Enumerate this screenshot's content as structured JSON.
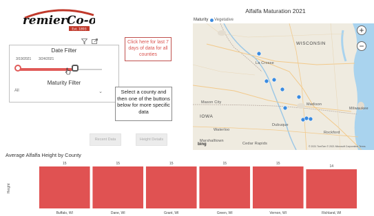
{
  "logo": {
    "text": "PremierCo-op",
    "subtext": "Est. 1893"
  },
  "date_filter": {
    "title": "Date Filter",
    "start_date": "3/19/2021",
    "end_date": "3/24/2021",
    "range_start_fraction": 0.0,
    "range_end_fraction": 0.68
  },
  "maturity_filter": {
    "title": "Maturity Filter",
    "selected": "All"
  },
  "last7_link": {
    "label": "Click here for last 7 days of data for all counties"
  },
  "instruction": {
    "text": "Select a county and then one of the buttons below for more specific data"
  },
  "buttons": {
    "recent": "Recent Data",
    "height": "Height Details"
  },
  "map": {
    "title": "Alfalfa Maturation 2021",
    "legend_label": "Maturity",
    "legend_item": "Vegetative",
    "legend_color": "#3b8be0",
    "labels": {
      "wisconsin": "WISCONSIN",
      "lacrosse": "La Crosse",
      "madison": "Madison",
      "milwaukee": "Milwaukee",
      "rockford": "Rockford",
      "iowa": "IOWA",
      "dubuque": "Dubuque",
      "mason_city": "Mason City",
      "waterloo": "Waterloo",
      "cedar_rapids": "Cedar Rapids",
      "marshalltown": "Marshalltown",
      "la_crosse_short": "Cresco"
    },
    "bing": "bing",
    "copyright": "© 2021 TomTom  © 2021 Microsoft Corporation  Terms"
  },
  "chart_data": {
    "type": "bar",
    "title": "Average Alfalfa Height by County",
    "ylabel": "Height",
    "categories": [
      "Buffalo, WI",
      "Dane, WI",
      "Grant, WI",
      "Green, WI",
      "Vernon, WI",
      "Richland, WI"
    ],
    "values": [
      15,
      15,
      15,
      15,
      15,
      14
    ],
    "color": "#e05252"
  }
}
